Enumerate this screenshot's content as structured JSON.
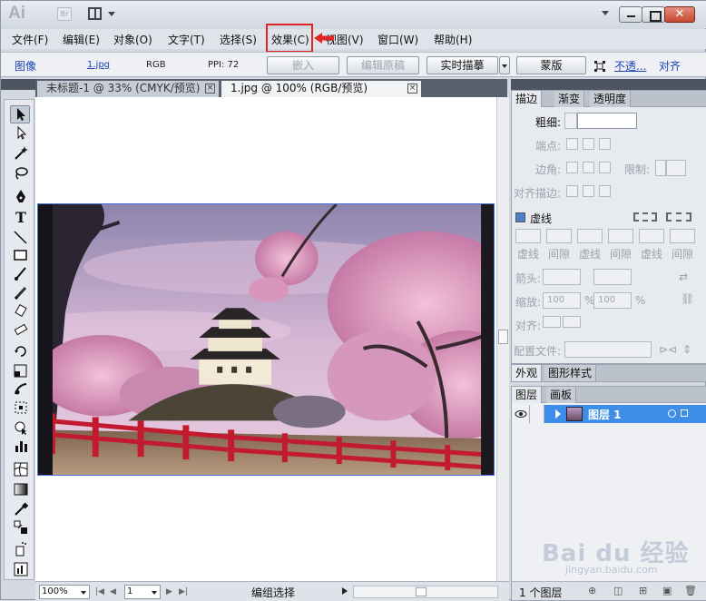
{
  "app": {
    "logo": "Ai",
    "bridge": "Br"
  },
  "menubar": {
    "items": [
      "文件(F)",
      "编辑(E)",
      "对象(O)",
      "文字(T)",
      "选择(S)",
      "效果(C)",
      "视图(V)",
      "窗口(W)",
      "帮助(H)"
    ]
  },
  "controlbar": {
    "label": "图像",
    "file": "1.jpg",
    "mode": "RGB",
    "ppi": "PPI: 72",
    "embed": "嵌入",
    "edit_original": "编辑原稿",
    "live_trace": "实时描摹",
    "mask": "蒙版",
    "opacity": "不透...",
    "align": "对齐"
  },
  "tabs": [
    {
      "title": "未标题-1 @ 33% (CMYK/预览)"
    },
    {
      "title": "1.jpg @ 100% (RGB/预览)"
    }
  ],
  "stroke_panel": {
    "tabs": [
      "描边",
      "渐变",
      "透明度"
    ],
    "weight": "粗细:",
    "cap": "端点:",
    "corner": "边角:",
    "limit": "限制:",
    "align_stroke": "对齐描边:",
    "dashed": "虚线",
    "dash_labels": [
      "虚线",
      "间隙",
      "虚线",
      "间隙",
      "虚线",
      "间隙"
    ],
    "arrow": "箭头:",
    "scale": "缩放:",
    "scale_val1": "100",
    "scale_val2": "100",
    "percent": "%",
    "align_arrow": "对齐:",
    "profile": "配置文件:"
  },
  "appearance_panel": {
    "tabs": [
      "外观",
      "图形样式"
    ]
  },
  "layers_panel": {
    "tabs": [
      "图层",
      "画板"
    ],
    "layer_name": "图层 1",
    "count": "1 个图层"
  },
  "status": {
    "zoom": "100%",
    "page": "1",
    "text": "编组选择"
  },
  "watermark": {
    "main": "Bai du 经验",
    "sub": "jingyan.baidu.com"
  },
  "colors": {
    "highlight": "#e02424",
    "selection": "#3e8ee8",
    "link": "#1b43b5"
  }
}
